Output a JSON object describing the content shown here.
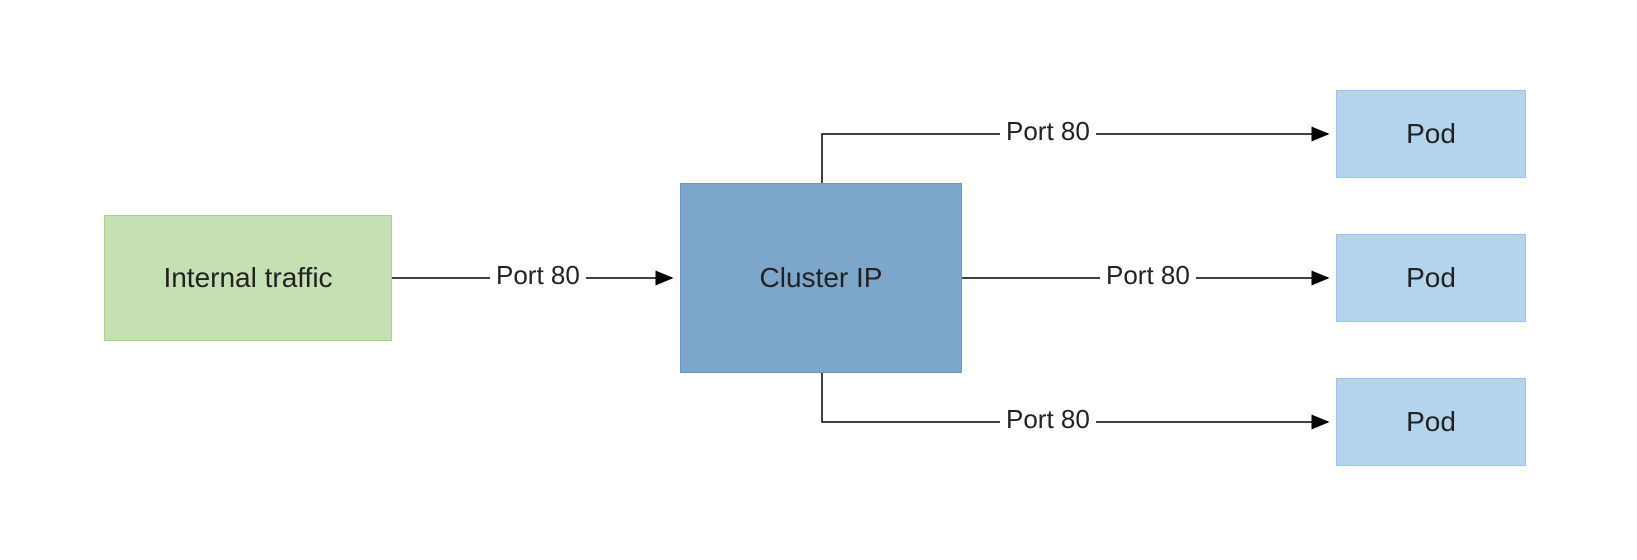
{
  "nodes": {
    "source": {
      "label": "Internal traffic"
    },
    "service": {
      "label": "Cluster IP"
    },
    "pod1": {
      "label": "Pod"
    },
    "pod2": {
      "label": "Pod"
    },
    "pod3": {
      "label": "Pod"
    }
  },
  "edges": {
    "source_to_service": {
      "label": "Port 80"
    },
    "service_to_pod1": {
      "label": "Port 80"
    },
    "service_to_pod2": {
      "label": "Port 80"
    },
    "service_to_pod3": {
      "label": "Port 80"
    }
  },
  "colors": {
    "green_fill": "#c5e0b3",
    "blue_dark_fill": "#7da7ca",
    "blue_light_fill": "#b4d3ed",
    "stroke": "#000000"
  }
}
